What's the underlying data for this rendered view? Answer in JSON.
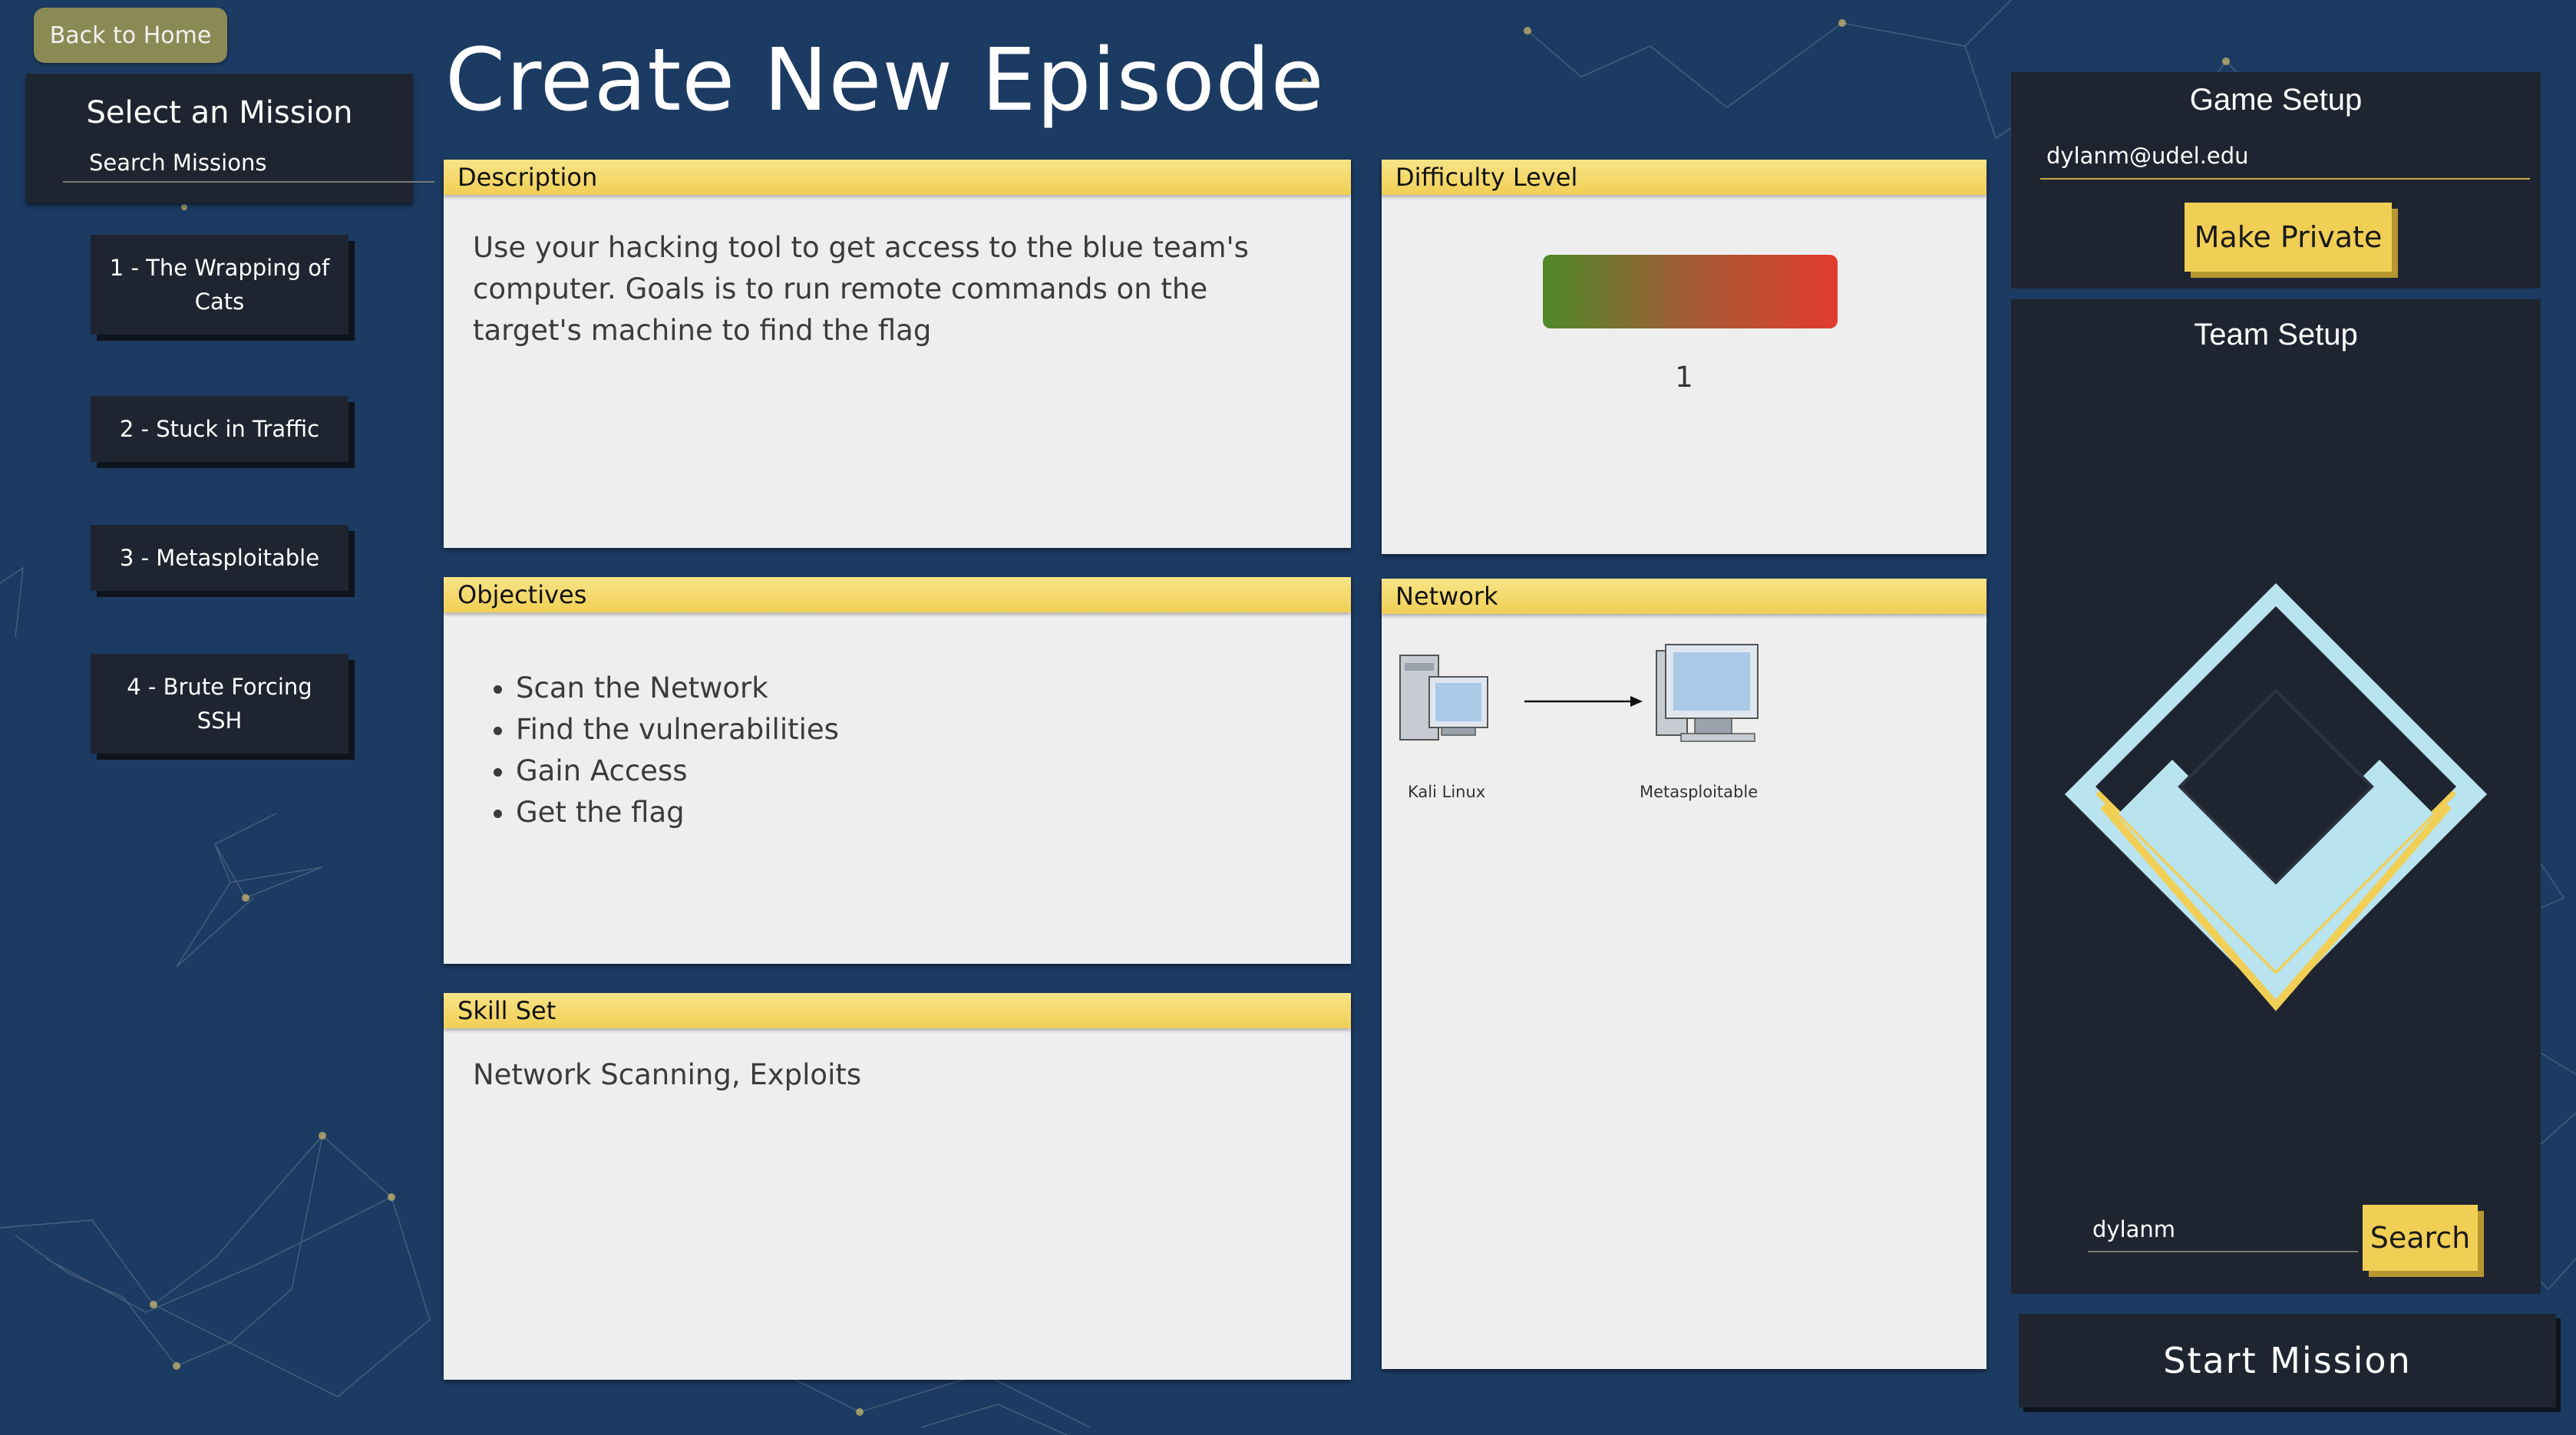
{
  "nav": {
    "back_label": "Back to Home"
  },
  "missions": {
    "title": "Select an Mission",
    "search_placeholder": "Search Missions",
    "items": [
      {
        "label": "1 - The Wrapping of Cats"
      },
      {
        "label": "2 - Stuck in Traffic"
      },
      {
        "label": "3 - Metasploitable"
      },
      {
        "label": "4 - Brute Forcing SSH"
      }
    ]
  },
  "page": {
    "title": "Create New Episode"
  },
  "description": {
    "header": "Description",
    "text": "Use your hacking tool to get access to the blue team's computer. Goals is to run remote commands on the target's machine to find the flag"
  },
  "difficulty": {
    "header": "Difficulty Level",
    "value": "1"
  },
  "objectives": {
    "header": "Objectives",
    "items": [
      "Scan the Network",
      "Find the vulnerabilities",
      "Gain Access",
      "Get the flag"
    ]
  },
  "skills": {
    "header": "Skill Set",
    "text": "Network Scanning, Exploits"
  },
  "network": {
    "header": "Network",
    "nodes": [
      "Kali Linux",
      "Metasploitable"
    ]
  },
  "game_setup": {
    "title": "Game Setup",
    "email": "dylanm@udel.edu",
    "private_label": "Make Private"
  },
  "team_setup": {
    "title": "Team Setup",
    "search_value": "dylanm",
    "search_label": "Search"
  },
  "start_label": "Start Mission",
  "colors": {
    "background": "#1c3b63",
    "panel": "#1f2530",
    "accent": "#f1cf55",
    "card": "#eeeeee"
  }
}
